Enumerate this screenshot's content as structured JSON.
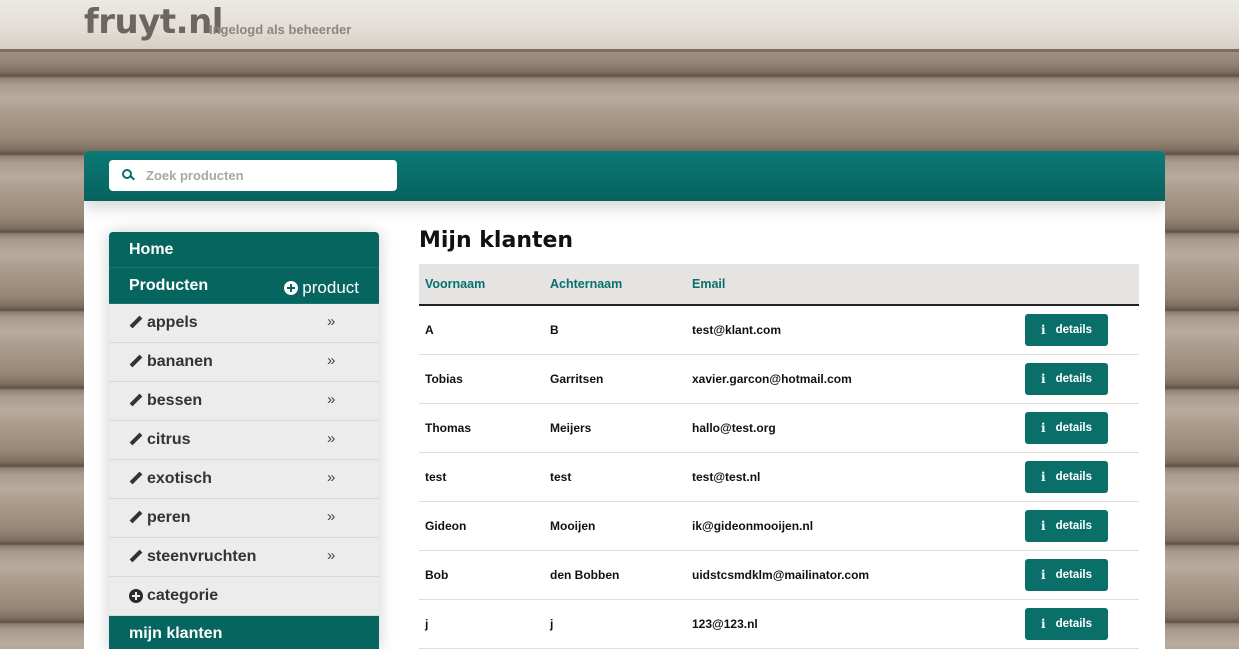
{
  "header": {
    "brand": "fruyt.nl",
    "subtitle": "Ingelogd als beheerder"
  },
  "search": {
    "placeholder": "Zoek producten",
    "value": ""
  },
  "sidebar": {
    "home": "Home",
    "products": "Producten",
    "add_product": "product",
    "categories": [
      {
        "label": "appels"
      },
      {
        "label": "bananen"
      },
      {
        "label": "bessen"
      },
      {
        "label": "citrus"
      },
      {
        "label": "exotisch"
      },
      {
        "label": "peren"
      },
      {
        "label": "steenvruchten"
      }
    ],
    "chevron": "»",
    "add_category": "categorie",
    "my_clients": "mijn klanten"
  },
  "main": {
    "title": "Mijn klanten",
    "columns": [
      "Voornaam",
      "Achternaam",
      "Email"
    ],
    "details_label": "details",
    "info_glyph": "i",
    "rows": [
      {
        "first": "A",
        "last": "B",
        "email": "test@klant.com"
      },
      {
        "first": "Tobias",
        "last": "Garritsen",
        "email": "xavier.garcon@hotmail.com"
      },
      {
        "first": "Thomas",
        "last": "Meijers",
        "email": "hallo@test.org"
      },
      {
        "first": "test",
        "last": "test",
        "email": "test@test.nl"
      },
      {
        "first": "Gideon",
        "last": "Mooijen",
        "email": "ik@gideonmooijen.nl"
      },
      {
        "first": "Bob",
        "last": "den Bobben",
        "email": "uidstcsmdklm@mailinator.com"
      },
      {
        "first": "j",
        "last": "j",
        "email": "123@123.nl"
      }
    ]
  },
  "colors": {
    "accent": "#07655f",
    "accent_light": "#0c7a75"
  }
}
